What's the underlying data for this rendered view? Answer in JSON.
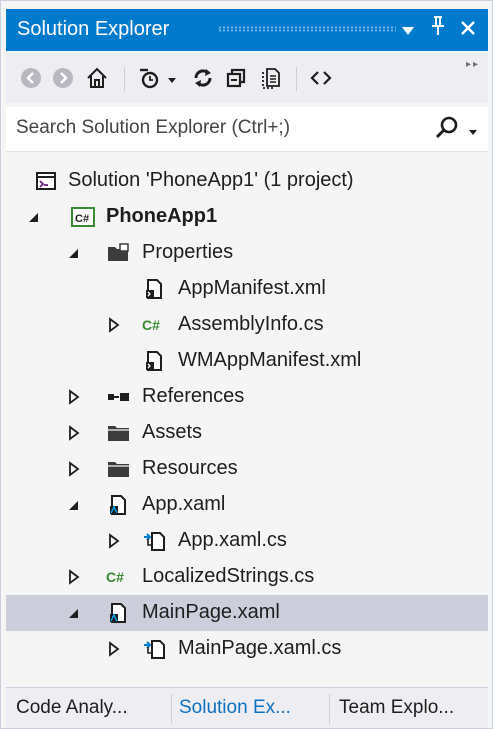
{
  "panel": {
    "title": "Solution Explorer",
    "dropdown_glyph": "▾",
    "pin_glyph": "ᛘ",
    "close_glyph": "✕"
  },
  "toolbar": {
    "back_icon": "back-arrow-icon",
    "forward_icon": "forward-arrow-icon",
    "home_icon": "home-icon",
    "pending_changes_icon": "pending-changes-clock-icon",
    "sync_icon": "sync-icon",
    "collapse_all_icon": "collapse-all-icon",
    "show_all_files_icon": "show-all-files-icon",
    "code_view_icon": "view-code-icon"
  },
  "search": {
    "placeholder": "Search Solution Explorer (Ctrl+;)"
  },
  "tree": {
    "items": [
      {
        "label": "Solution 'PhoneApp1' (1 project)",
        "icon": "solution-icon",
        "expander": "none"
      },
      {
        "label": "PhoneApp1",
        "icon": "csharp-project-icon",
        "expander": "expanded",
        "bold": true
      },
      {
        "label": "Properties",
        "icon": "properties-folder-icon",
        "expander": "expanded"
      },
      {
        "label": "AppManifest.xml",
        "icon": "xml-file-icon",
        "expander": "none"
      },
      {
        "label": "AssemblyInfo.cs",
        "icon": "csharp-file-icon",
        "expander": "collapsed"
      },
      {
        "label": "WMAppManifest.xml",
        "icon": "xml-file-icon",
        "expander": "none"
      },
      {
        "label": "References",
        "icon": "references-icon",
        "expander": "collapsed"
      },
      {
        "label": "Assets",
        "icon": "folder-icon",
        "expander": "collapsed"
      },
      {
        "label": "Resources",
        "icon": "folder-icon",
        "expander": "collapsed"
      },
      {
        "label": "App.xaml",
        "icon": "xaml-file-icon",
        "expander": "expanded"
      },
      {
        "label": "App.xaml.cs",
        "icon": "code-behind-file-icon",
        "expander": "collapsed"
      },
      {
        "label": "LocalizedStrings.cs",
        "icon": "csharp-file-icon",
        "expander": "collapsed"
      },
      {
        "label": "MainPage.xaml",
        "icon": "xaml-file-icon",
        "expander": "expanded",
        "selected": true
      },
      {
        "label": "MainPage.xaml.cs",
        "icon": "code-behind-file-icon",
        "expander": "collapsed"
      }
    ]
  },
  "tabs": [
    {
      "label": "Code Analy...",
      "active": false
    },
    {
      "label": "Solution Ex...",
      "active": true
    },
    {
      "label": "Team Explo...",
      "active": false
    }
  ],
  "colors": {
    "accent": "#007acc",
    "selection": "#cccedb",
    "active_tab_text": "#0e70c0",
    "csharp_green": "#388a34"
  }
}
